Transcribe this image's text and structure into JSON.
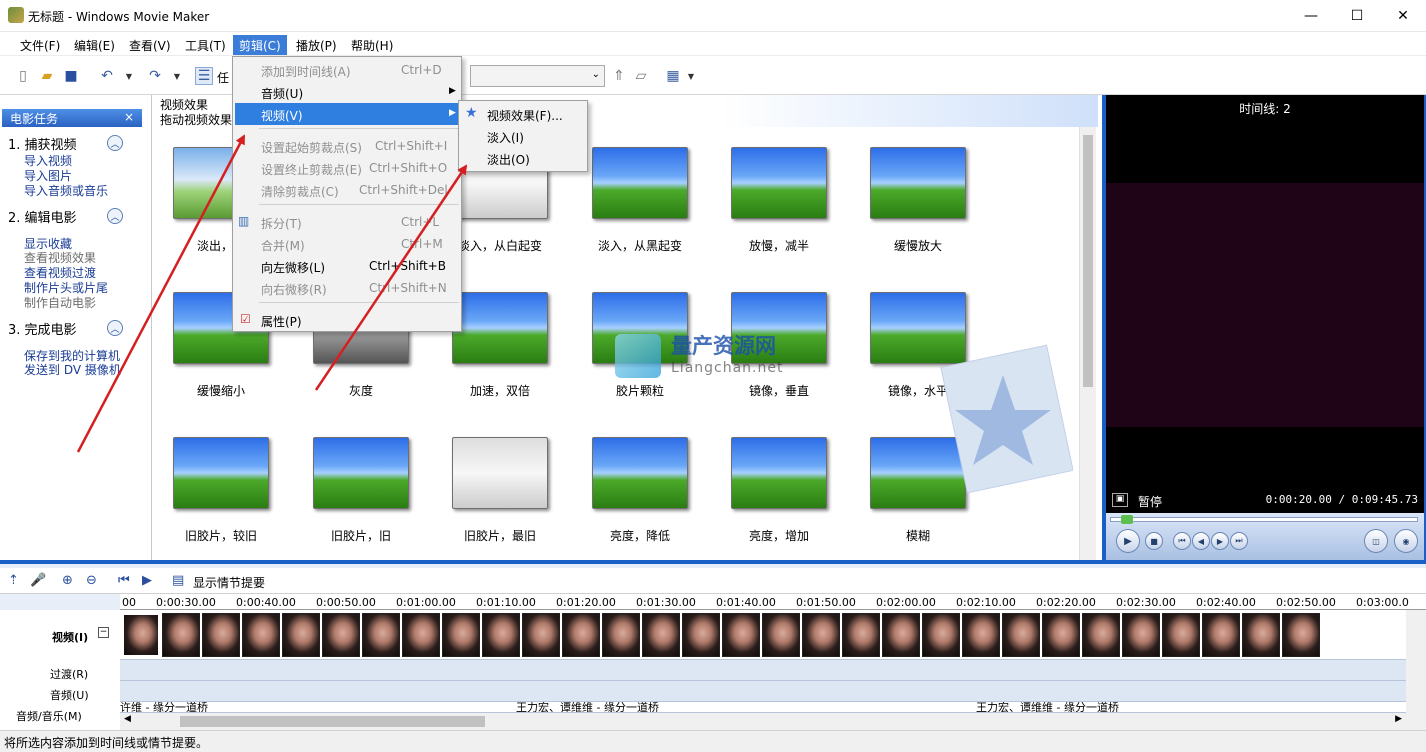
{
  "window": {
    "title": "无标题 - Windows Movie Maker"
  },
  "menubar": [
    {
      "label": "文件(F)"
    },
    {
      "label": "编辑(E)"
    },
    {
      "label": "查看(V)"
    },
    {
      "label": "工具(T)"
    },
    {
      "label": "剪辑(C)"
    },
    {
      "label": "播放(P)"
    },
    {
      "label": "帮助(H)"
    }
  ],
  "toolbar": {
    "tasks_label": "任"
  },
  "taskpane": {
    "header": "电影任务",
    "sections": [
      {
        "title": "1.  捕获视频",
        "links": [
          "导入视频",
          "导入图片",
          "导入音频或音乐"
        ]
      },
      {
        "title": "2.  编辑电影",
        "links": [
          "显示收藏",
          "查看视频效果",
          "查看视频过渡",
          "制作片头或片尾",
          "制作自动电影"
        ]
      },
      {
        "title": "3.  完成电影",
        "links": [
          "保存到我的计算机",
          "发送到 DV 摄像机"
        ]
      }
    ]
  },
  "content": {
    "title": "视频效果",
    "subtitle": "拖动视频效果",
    "items": [
      "淡出，变",
      "",
      "淡入，从白起变",
      "淡入，从黑起变",
      "放慢，减半",
      "缓慢放大",
      "缓慢缩小",
      "灰度",
      "加速，双倍",
      "胶片颗粒",
      "镜像，垂直",
      "镜像，水平",
      "旧胶片，较旧",
      "旧胶片，旧",
      "旧胶片，最旧",
      "亮度，降低",
      "亮度，增加",
      "模糊"
    ]
  },
  "watermark": {
    "cn": "量产资源网",
    "en": "Liangchan.net"
  },
  "preview": {
    "header": "时间线: 2",
    "status": "暂停",
    "time": "0:00:20.00 / 0:09:45.73"
  },
  "storyboard": {
    "show_label": "显示情节提要",
    "ruler": [
      "00",
      "0:00:30.00",
      "0:00:40.00",
      "0:00:50.00",
      "0:01:00.00",
      "0:01:10.00",
      "0:01:20.00",
      "0:01:30.00",
      "0:01:40.00",
      "0:01:50.00",
      "0:02:00.00",
      "0:02:10.00",
      "0:02:20.00",
      "0:02:30.00",
      "0:02:40.00",
      "0:02:50.00",
      "0:03:00.0"
    ],
    "tracks": {
      "video": "视频(I)",
      "transition": "过渡(R)",
      "audio": "音频(U)",
      "music": "音频/音乐(M)"
    },
    "music_clips": [
      "许维 - 缘分一道桥",
      "王力宏、谭维维 - 缘分一道桥",
      "王力宏、谭维维 - 缘分一道桥"
    ]
  },
  "statusbar": {
    "text": "将所选内容添加到时间线或情节提要。"
  },
  "clip_menu": {
    "items": [
      {
        "label": "添加到时间线(A)",
        "shortcut": "Ctrl+D"
      },
      {
        "label": "音频(U)",
        "shortcut": ""
      },
      {
        "label": "视频(V)",
        "shortcut": ""
      },
      {
        "label": "设置起始剪裁点(S)",
        "shortcut": "Ctrl+Shift+I"
      },
      {
        "label": "设置终止剪裁点(E)",
        "shortcut": "Ctrl+Shift+O"
      },
      {
        "label": "清除剪裁点(C)",
        "shortcut": "Ctrl+Shift+Del"
      },
      {
        "label": "拆分(T)",
        "shortcut": "Ctrl+L"
      },
      {
        "label": "合并(M)",
        "shortcut": "Ctrl+M"
      },
      {
        "label": "向左微移(L)",
        "shortcut": "Ctrl+Shift+B"
      },
      {
        "label": "向右微移(R)",
        "shortcut": "Ctrl+Shift+N"
      },
      {
        "label": "属性(P)",
        "shortcut": ""
      }
    ]
  },
  "video_submenu": {
    "items": [
      {
        "label": "视频效果(F)..."
      },
      {
        "label": "淡入(I)"
      },
      {
        "label": "淡出(O)"
      }
    ]
  },
  "colors": {
    "accent": "#1a5fc8",
    "highlight": "#2f7fe0",
    "arrow": "#d42020"
  }
}
